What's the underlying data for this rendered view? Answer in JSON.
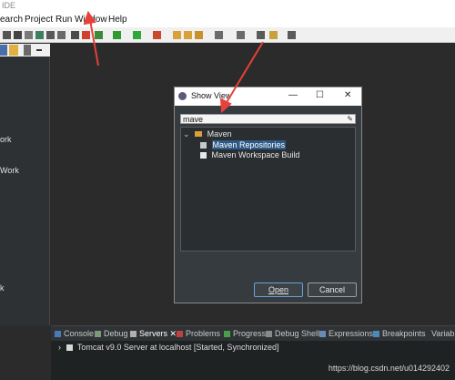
{
  "titlebar": {
    "text": "IDE"
  },
  "menubar": {
    "items": [
      "earch",
      "Project",
      "Run",
      "Window",
      "Help"
    ]
  },
  "left_panel": {
    "items": [
      "ork",
      "Work",
      "k"
    ]
  },
  "dialog": {
    "title": "Show View",
    "filter_value": "mave",
    "tree": {
      "folder": "Maven",
      "children": [
        "Maven Repositories",
        "Maven Workspace Build"
      ]
    },
    "open_label": "Open",
    "cancel_label": "Cancel",
    "controls": {
      "minimize": "—",
      "maximize": "☐",
      "close": "✕"
    }
  },
  "view_tabs": [
    "Console",
    "Debug",
    "Servers",
    "Problems",
    "Progress",
    "Debug Shell",
    "Expressions",
    "Breakpoints",
    "Variab"
  ],
  "active_tab": "Servers",
  "servers": {
    "row": "Tomcat v9.0 Server at localhost  [Started, Synchronized]"
  },
  "watermark": "https://blog.csdn.net/u014292402",
  "colors": {
    "annotation": "#e8403a",
    "selection": "#2f5a87",
    "dark_bg": "#2b2b2b"
  }
}
